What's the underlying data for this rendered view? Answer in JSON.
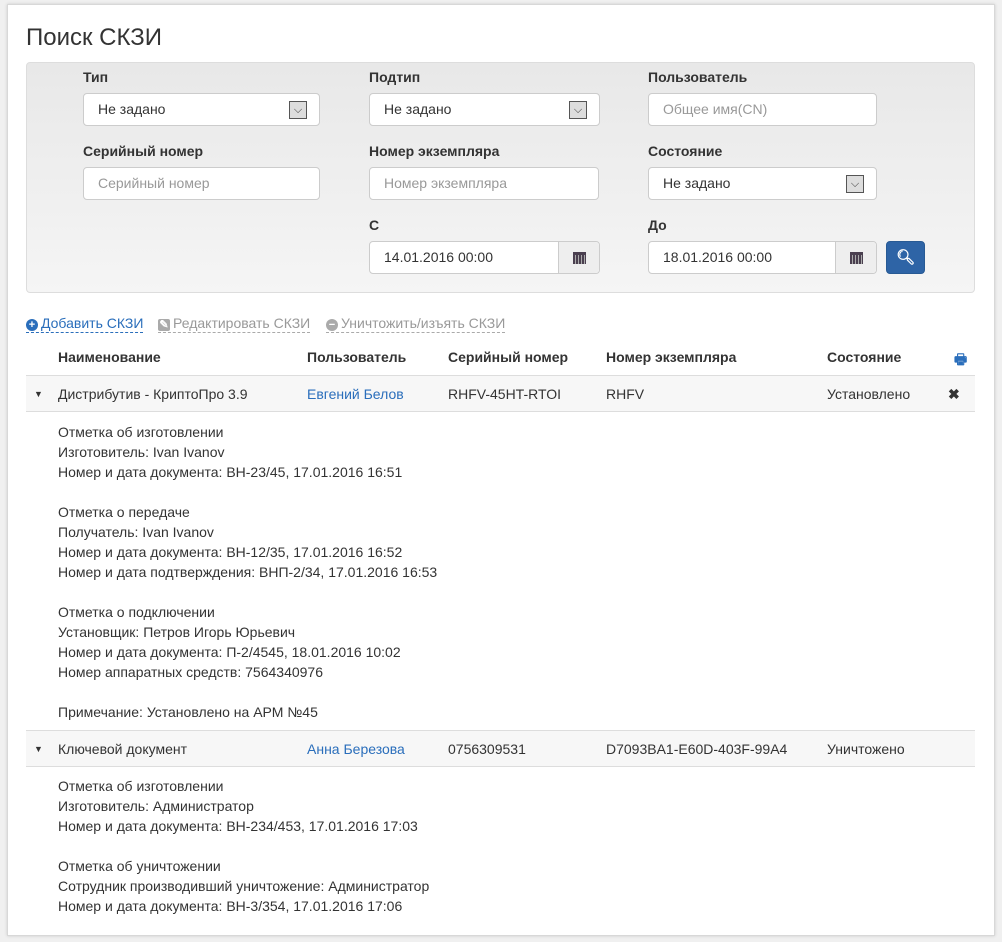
{
  "page": {
    "title": "Поиск СКЗИ"
  },
  "filters": {
    "type": {
      "label": "Тип",
      "value": "Не задано"
    },
    "subtype": {
      "label": "Подтип",
      "value": "Не задано"
    },
    "user": {
      "label": "Пользователь",
      "placeholder": "Общее имя(CN)"
    },
    "serial": {
      "label": "Серийный номер",
      "placeholder": "Серийный номер"
    },
    "instance": {
      "label": "Номер экземпляра",
      "placeholder": "Номер экземпляра"
    },
    "state": {
      "label": "Состояние",
      "value": "Не задано"
    },
    "from": {
      "label": "С",
      "value": "14.01.2016 00:00"
    },
    "to": {
      "label": "До",
      "value": "18.01.2016 00:00"
    }
  },
  "actions": {
    "add": "Добавить СКЗИ",
    "edit": "Редактировать СКЗИ",
    "destroy": "Уничтожить/изъять СКЗИ"
  },
  "table": {
    "headers": [
      "Наименование",
      "Пользователь",
      "Серийный номер",
      "Номер экземпляра",
      "Состояние"
    ],
    "rows": [
      {
        "name": "Дистрибутив - КриптоПро 3.9",
        "user": "Евгений Белов",
        "serial": "RHFV-45HT-RTOI",
        "instance": "RHFV",
        "state": "Установлено",
        "details": [
          "Отметка об изготовлении",
          "Изготовитель: Ivan Ivanov",
          "Номер и дата документа: ВН-23/45, 17.01.2016 16:51",
          "",
          "Отметка о передаче",
          "Получатель: Ivan Ivanov",
          "Номер и дата документа: ВН-12/35, 17.01.2016 16:52",
          "Номер и дата подтверждения: ВНП-2/34, 17.01.2016 16:53",
          "",
          "Отметка о подключении",
          "Установщик: Петров Игорь Юрьевич",
          "Номер и дата документа: П-2/4545, 18.01.2016 10:02",
          "Номер аппаратных средств: 7564340976",
          "",
          "Примечание: Установлено на АРМ №45"
        ]
      },
      {
        "name": "Ключевой документ",
        "user": "Анна Березова",
        "serial": "0756309531",
        "instance": "D7093BA1-E60D-403F-99A4",
        "state": "Уничтожено",
        "details": [
          "Отметка об изготовлении",
          "Изготовитель: Администратор",
          "Номер и дата документа: ВН-234/453, 17.01.2016 17:03",
          "",
          "Отметка об уничтожении",
          "Сотрудник производивший уничтожение:  Администратор",
          "Номер и дата документа: ВН-3/354, 17.01.2016 17:06"
        ]
      }
    ]
  },
  "colors": {
    "accent": "#2a6ebb",
    "button": "#2e64a6"
  }
}
